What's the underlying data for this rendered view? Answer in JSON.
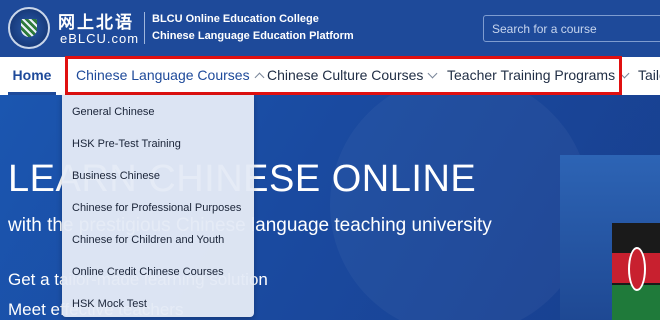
{
  "header": {
    "logo_cn": "网上北语",
    "logo_en": "eBLCU.com",
    "college_line1": "BLCU Online Education College",
    "college_line2": "Chinese Language Education Platform",
    "search_placeholder": "Search for a course"
  },
  "nav": {
    "items": [
      {
        "label": "Home"
      },
      {
        "label": "Chinese Language Courses"
      },
      {
        "label": "Chinese Culture Courses"
      },
      {
        "label": "Teacher Training Programs"
      },
      {
        "label": "Tailo"
      }
    ]
  },
  "dropdown": {
    "items": [
      {
        "label": "General Chinese"
      },
      {
        "label": "HSK Pre-Test Training"
      },
      {
        "label": "Business Chinese"
      },
      {
        "label": "Chinese for Professional Purposes"
      },
      {
        "label": "Chinese for Children and Youth"
      },
      {
        "label": "Online Credit Chinese Courses"
      },
      {
        "label": "HSK Mock Test"
      }
    ]
  },
  "hero": {
    "title": "LEARN CHINESE ONLINE",
    "subtitle": "with the prestigious Chinese language teaching university",
    "line1": "Get a tailor-made learning solution",
    "line2": "Meet effective teachers"
  },
  "colors": {
    "brand": "#1e4a9a",
    "highlight": "#e01010"
  }
}
